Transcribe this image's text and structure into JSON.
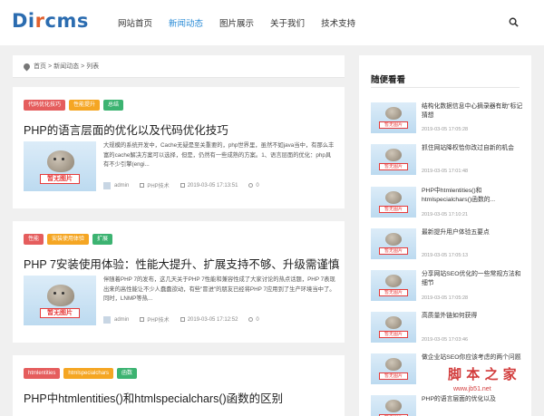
{
  "header": {
    "logo": {
      "part1": "Di",
      "part2": "r",
      "part3": "cms"
    },
    "nav": [
      "网站首页",
      "新闻动态",
      "图片展示",
      "关于我们",
      "技术支持"
    ],
    "active_nav": "新闻动态",
    "search_icon": "search-icon"
  },
  "breadcrumb": {
    "items": [
      "首页",
      ">",
      "新闻动态",
      ">",
      "列表"
    ],
    "icon": "location-pin-icon"
  },
  "posts": [
    {
      "tags": [
        {
          "label": "代码优化技巧",
          "color": "#e55d5d"
        },
        {
          "label": "性能提升",
          "color": "#f5a623"
        },
        {
          "label": "总结",
          "color": "#3cb371"
        }
      ],
      "title": "PHP的语言层面的优化以及代码优化技巧",
      "thumb_label": "暂无图片",
      "excerpt": "大规模的系统开发中，Cache无疑是至关重要的，php世界里，虽然不如java当中，有那么丰富的cache解决方案可以选择，但是，仍然有一些成熟的方案。1、语言层面的优化：php具有不少引擎(engi...",
      "author": "admin",
      "category": "PHP技术",
      "date": "2019-03-05 17:13:51",
      "comments": "0"
    },
    {
      "tags": [
        {
          "label": "性能",
          "color": "#e55d5d"
        },
        {
          "label": "安装使用体验",
          "color": "#f5a623"
        },
        {
          "label": "扩展",
          "color": "#3cb371"
        }
      ],
      "title": "PHP 7安装使用体验：性能大提升、扩展支持不够、升级需谨慎",
      "thumb_label": "暂无图片",
      "excerpt": "伴随着PHP 7的发布，这几天关于PHP 7性能和兼容性成了大家讨论的热点话题，PHP 7表现出来的高性能让不少人蠢蠢欲动，有些\"冒进\"的朋友已经将PHP 7应用到了生产环境当中了。同时，LNMP等热...",
      "author": "admin",
      "category": "PHP技术",
      "date": "2019-03-05 17:12:52",
      "comments": "0"
    },
    {
      "tags": [
        {
          "label": "htmlentities",
          "color": "#e55d5d"
        },
        {
          "label": "htmlspecialchars",
          "color": "#f5a623"
        },
        {
          "label": "函数",
          "color": "#3cb371"
        }
      ],
      "title": "PHP中htmlentities()和htmlspecialchars()函数的区别"
    }
  ],
  "sidebar": {
    "title": "随便看看",
    "thumb_label": "暂无图片",
    "items": [
      {
        "title": "结构化数据信息中心摘录器有助\"标记猜想",
        "date": "2019-03-05 17:05:28"
      },
      {
        "title": "抓住网站降权恰你改过自新的机会",
        "date": "2019-03-05 17:01:48"
      },
      {
        "title": "PHP中htmlentities()和htmlspecialchars()函数的...",
        "date": "2019-03-05 17:10:21"
      },
      {
        "title": "最新提升用户体验五要点",
        "date": "2019-03-05 17:05:13"
      },
      {
        "title": "分享网站SEO优化的一些常规方法和细节",
        "date": "2019-03-05 17:05:28"
      },
      {
        "title": "高质量外链如何获得",
        "date": "2019-03-05 17:03:46"
      },
      {
        "title": "做企业站SEO你应该考虑的两个问题",
        "date": ""
      },
      {
        "title": "PHP的语言层面的优化以及",
        "date": ""
      }
    ]
  },
  "watermark": {
    "line1": "脚 本 之 家",
    "line2": "www.jb51.net"
  }
}
